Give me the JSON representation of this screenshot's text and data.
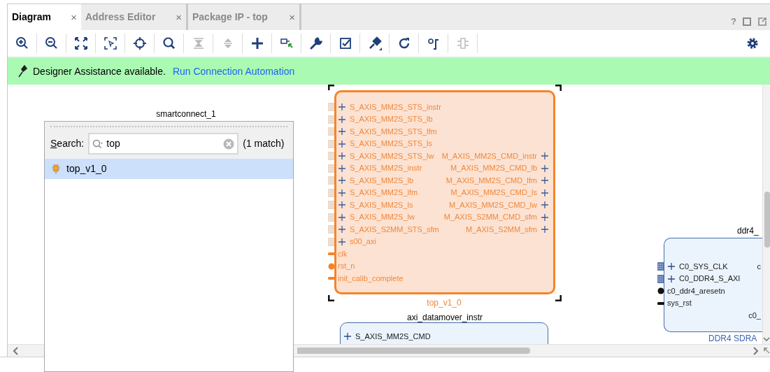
{
  "tabs": [
    {
      "label": "Diagram",
      "close": "×",
      "selected": true
    },
    {
      "label": "Address Editor",
      "close": "×",
      "selected": false
    },
    {
      "label": "Package IP - top",
      "close": "×",
      "selected": false
    }
  ],
  "window_controls": {
    "help": "?"
  },
  "toolbar": [
    {
      "kind": "zoom-in",
      "disabled": false
    },
    {
      "kind": "zoom-out",
      "disabled": false
    },
    {
      "kind": "fit",
      "disabled": false
    },
    {
      "kind": "select-area",
      "disabled": false
    },
    {
      "kind": "crosshair",
      "disabled": false
    },
    {
      "kind": "search",
      "disabled": false
    },
    {
      "kind": "collapse",
      "disabled": true
    },
    {
      "kind": "expand",
      "disabled": true
    },
    {
      "kind": "add",
      "disabled": false
    },
    {
      "kind": "connect",
      "disabled": false
    },
    {
      "kind": "wrench",
      "disabled": false
    },
    {
      "kind": "validate",
      "disabled": false
    },
    {
      "kind": "pin",
      "disabled": false
    },
    {
      "kind": "refresh",
      "disabled": false
    },
    {
      "kind": "regenerate",
      "disabled": false
    },
    {
      "kind": "chip",
      "disabled": true
    },
    {
      "kind": "settings",
      "disabled": false
    }
  ],
  "banner": {
    "text": "Designer Assistance available.",
    "link": "Run Connection Automation"
  },
  "diagram": {
    "labels": [
      "smartconnect_1"
    ],
    "blocks": [
      {
        "selected": true,
        "subtitle": "top_v1_0",
        "left_ports": [
          {
            "name": "S_AXIS_MM2S_STS_instr",
            "kind": "bus"
          },
          {
            "name": "S_AXIS_MM2S_STS_lb",
            "kind": "bus"
          },
          {
            "name": "S_AXIS_MM2S_STS_lfm",
            "kind": "bus"
          },
          {
            "name": "S_AXIS_MM2S_STS_ls",
            "kind": "bus"
          },
          {
            "name": "S_AXIS_MM2S_STS_lw",
            "kind": "bus"
          },
          {
            "name": "S_AXIS_MM2S_instr",
            "kind": "bus"
          },
          {
            "name": "S_AXIS_MM2S_lb",
            "kind": "bus"
          },
          {
            "name": "S_AXIS_MM2S_lfm",
            "kind": "bus"
          },
          {
            "name": "S_AXIS_MM2S_ls",
            "kind": "bus"
          },
          {
            "name": "S_AXIS_MM2S_lw",
            "kind": "bus"
          },
          {
            "name": "S_AXIS_S2MM_STS_sfm",
            "kind": "bus"
          },
          {
            "name": "s00_axi",
            "kind": "bus"
          },
          {
            "name": "clk",
            "kind": "signal"
          },
          {
            "name": "rst_n",
            "kind": "reset"
          },
          {
            "name": "init_calib_complete",
            "kind": "signal"
          }
        ],
        "right_ports": [
          {
            "name": "M_AXIS_MM2S_CMD_instr",
            "kind": "bus"
          },
          {
            "name": "M_AXIS_MM2S_CMD_lb",
            "kind": "bus"
          },
          {
            "name": "M_AXIS_MM2S_CMD_lfm",
            "kind": "bus"
          },
          {
            "name": "M_AXIS_MM2S_CMD_ls",
            "kind": "bus"
          },
          {
            "name": "M_AXIS_MM2S_CMD_lw",
            "kind": "bus"
          },
          {
            "name": "M_AXIS_S2MM_CMD_sfm",
            "kind": "bus"
          },
          {
            "name": "M_AXIS_S2MM_sfm",
            "kind": "bus"
          }
        ]
      },
      {
        "selected": false,
        "title": "axi_datamover_instr",
        "left_ports": [
          {
            "name": "S_AXIS_MM2S_CMD",
            "kind": "bus"
          }
        ]
      },
      {
        "selected": false,
        "title": "ddr4_",
        "subtitle": "DDR4 SDRA",
        "left_ports": [
          {
            "name": "C0_SYS_CLK",
            "kind": "bus"
          },
          {
            "name": "C0_DDR4_S_AXI",
            "kind": "bus"
          },
          {
            "name": "c0_ddr4_aresetn",
            "kind": "reset"
          },
          {
            "name": "sys_rst",
            "kind": "signal"
          }
        ],
        "right_ports": [
          {
            "name": "c",
            "kind": "signal"
          },
          {
            "name": "c0_",
            "kind": "signal"
          }
        ]
      }
    ]
  },
  "search_popup": {
    "label": "Search:",
    "value": "top",
    "match_count": "(1 match)",
    "results": [
      {
        "label": "top_v1_0",
        "selected": true
      }
    ]
  }
}
